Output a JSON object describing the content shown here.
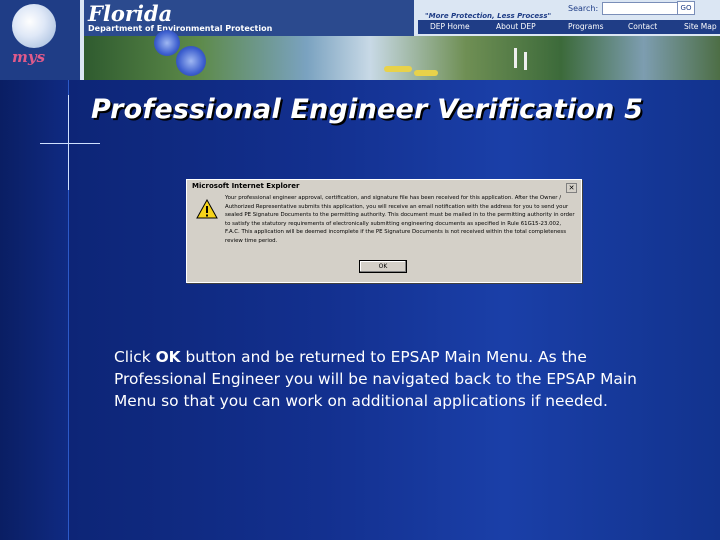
{
  "header": {
    "agency_name": "Florida",
    "department": "Department of Environmental Protection",
    "motto": "\"More Protection, Less Process\"",
    "search_label": "Search:",
    "search_value": "",
    "go_label": "GO",
    "nav": [
      "DEP Home",
      "About DEP",
      "Programs",
      "Contact",
      "Site Map"
    ]
  },
  "slide": {
    "title": "Professional Engineer Verification 5",
    "instruction_prefix": "Click ",
    "instruction_bold": "OK",
    "instruction_rest": " button and be returned to EPSAP Main Menu.  As the Professional Engineer you will be navigated back to the EPSAP Main Menu so that you can work on additional applications if needed."
  },
  "dialog": {
    "title": "Microsoft Internet Explorer",
    "close_label": "✕",
    "message": "Your professional engineer approval, certification, and signature file has been received for this application. After the Owner / Authorized Representative submits this application, you will receive an email notification with the address for you to send your sealed PE Signature Documents to the permitting authority. This document must be mailed in to the permitting authority in order to satisfy the statutory requirements of electronically submitting engineering documents as specified in Rule 61G15-23.002, F.A.C. This application will be deemed incomplete if the PE Signature Documents is not received within the total completeness review time period.",
    "ok_label": "OK"
  }
}
